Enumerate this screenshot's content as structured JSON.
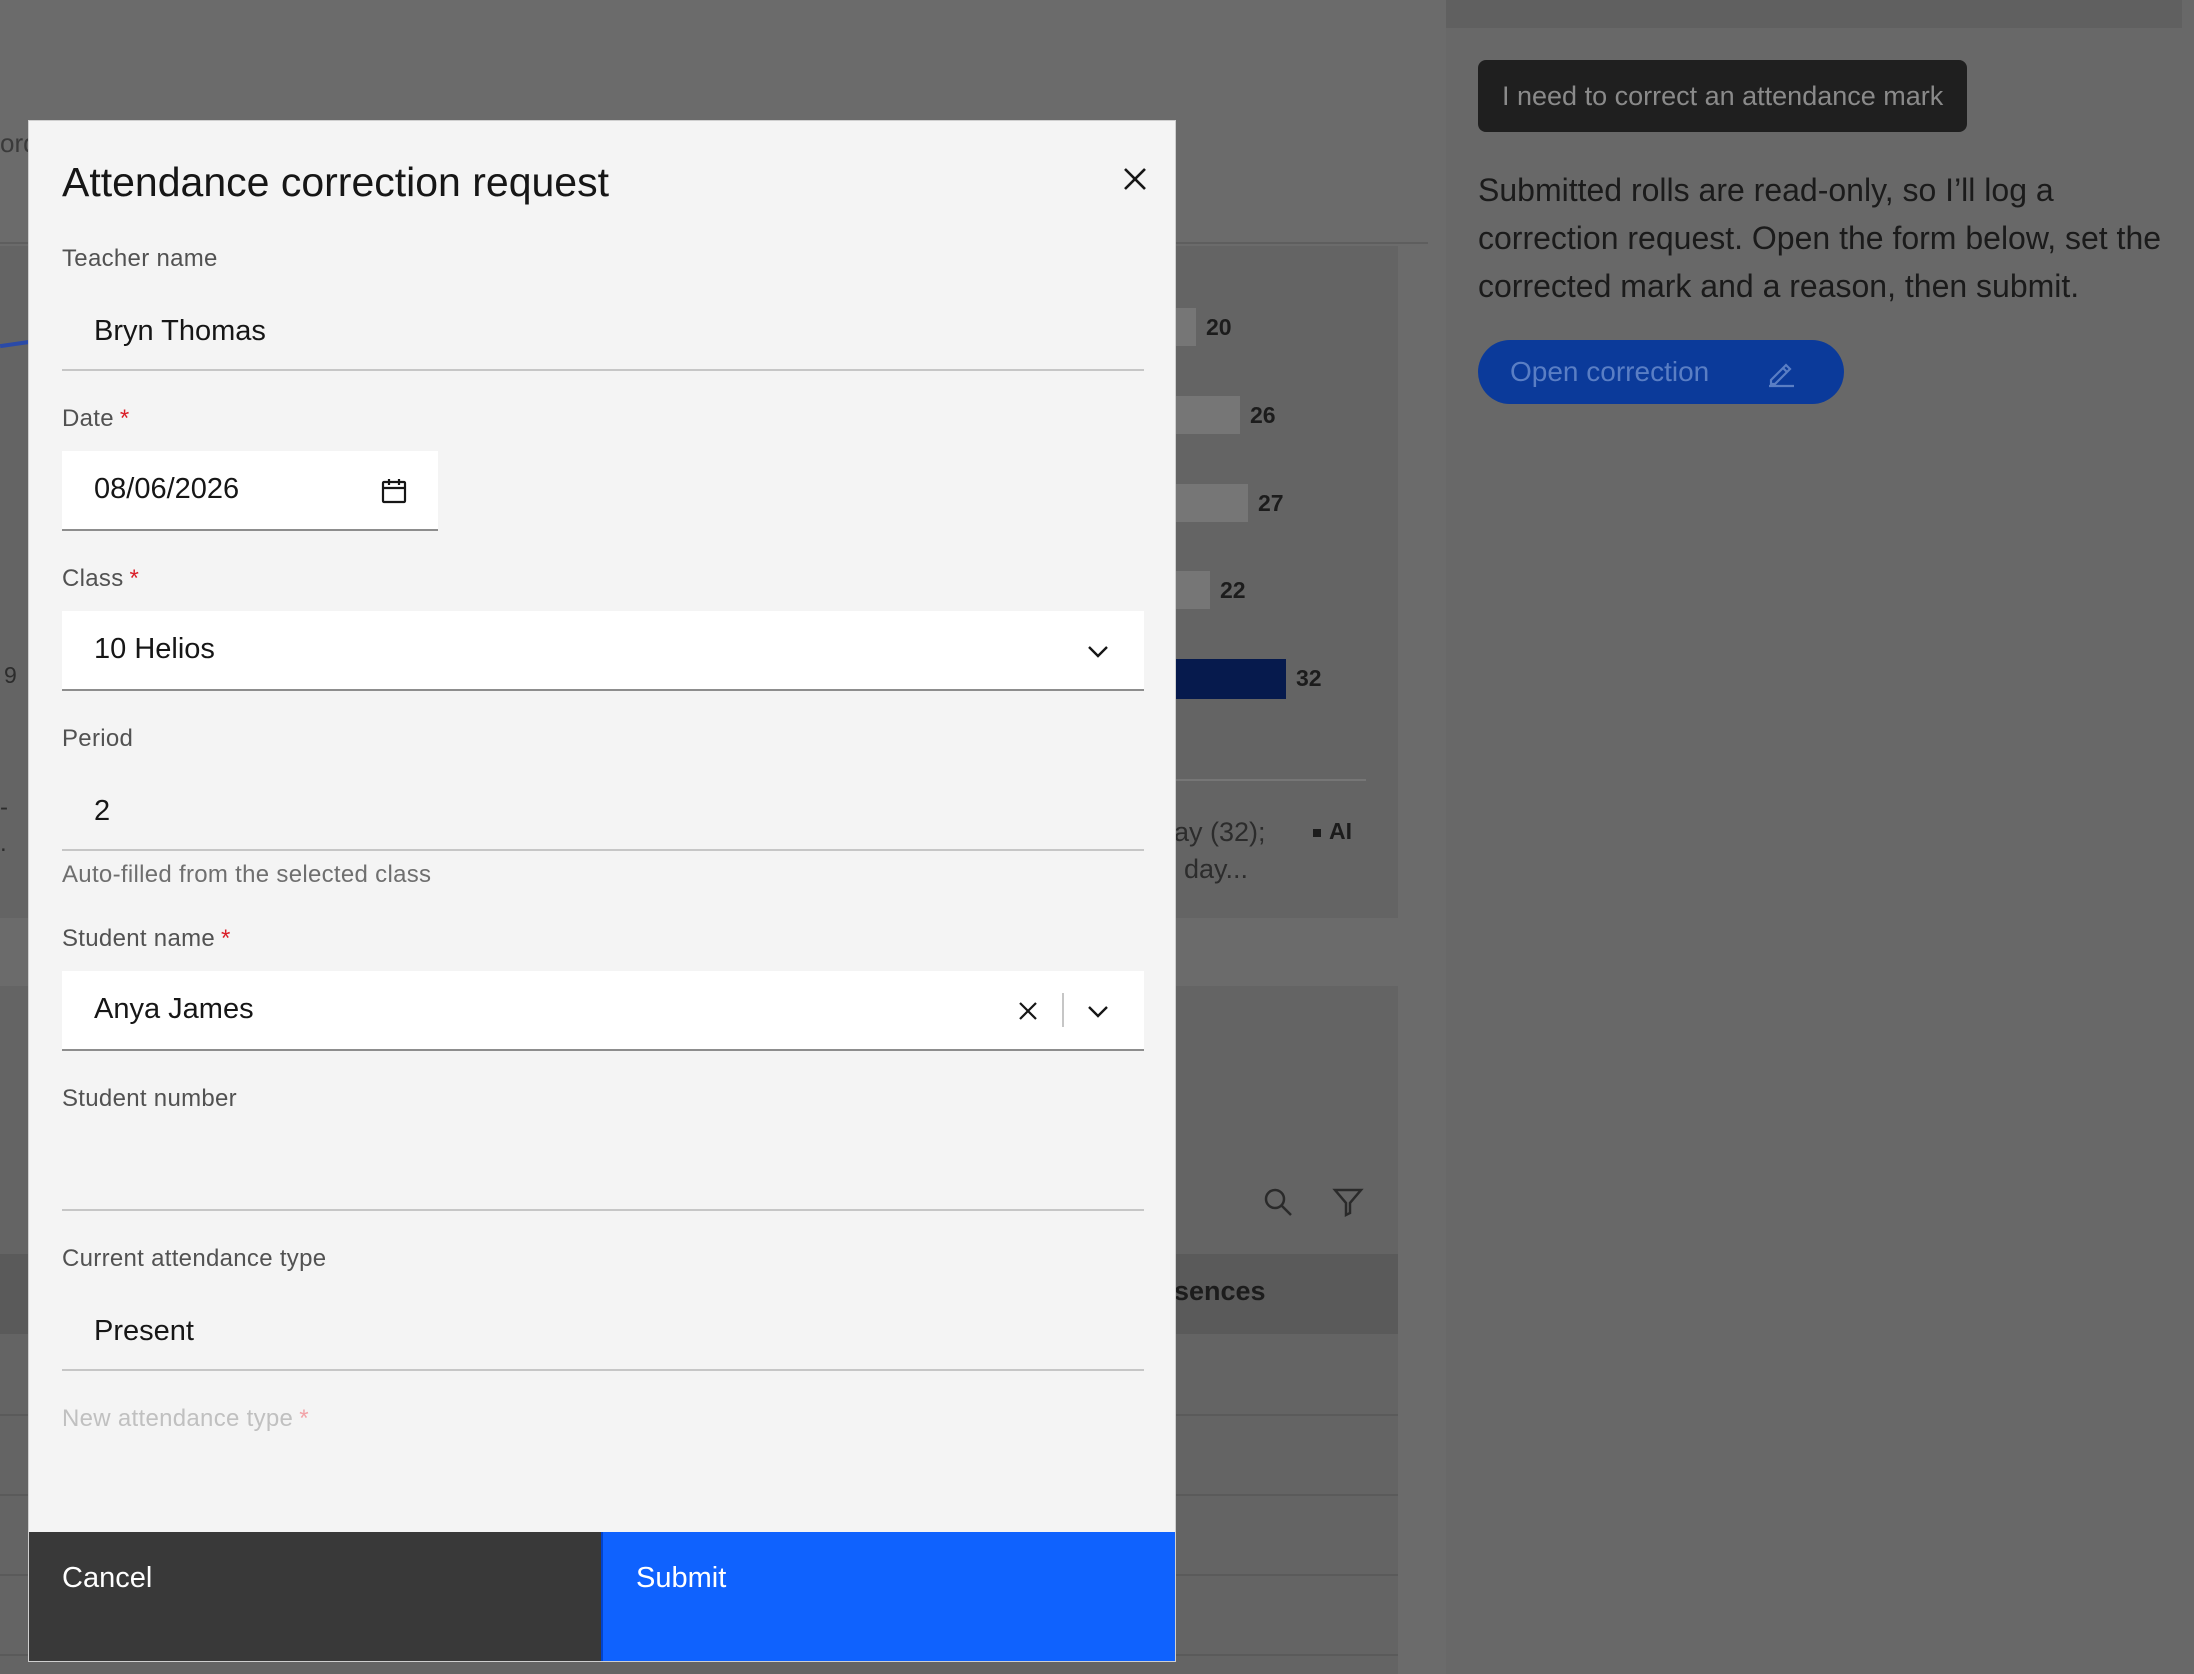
{
  "background": {
    "cut_text": "ord",
    "chart": {
      "bars": [
        {
          "value": "20"
        },
        {
          "value": "26"
        },
        {
          "value": "27"
        },
        {
          "value": "22"
        },
        {
          "value": "32",
          "highlighted": true
        }
      ],
      "axis_fragment": "9",
      "summary_line1": "ay (32);",
      "summary_line2": "day...",
      "ai_tag": "AI",
      "left_fragment": "-\n."
    },
    "table": {
      "column_header": "sences"
    },
    "accent_color": "#061a4d"
  },
  "side_panel": {
    "user_message": "I need to correct an attendance mark",
    "assistant_message": "Submitted rolls are read-only, so I’ll log a correction request. Open the form below, set the corrected mark and a reason, then submit.",
    "open_button": "Open correction",
    "open_button_icon": "pencil-icon"
  },
  "modal": {
    "title": "Attendance correction request",
    "close_icon": "close-icon",
    "fields": {
      "teacher": {
        "label": "Teacher name",
        "value": "Bryn Thomas"
      },
      "date": {
        "label": "Date",
        "required": "*",
        "value": "08/06/2026",
        "icon": "calendar-icon"
      },
      "class": {
        "label": "Class",
        "required": "*",
        "value": "10 Helios",
        "icon": "chevron-down-icon"
      },
      "period": {
        "label": "Period",
        "value": "2",
        "helper": "Auto-filled from the selected class"
      },
      "student_name": {
        "label": "Student name",
        "required": "*",
        "value": "Anya James"
      },
      "student_number": {
        "label": "Student number",
        "value": ""
      },
      "current_type": {
        "label": "Current attendance type",
        "value": "Present"
      },
      "new_type": {
        "label": "New attendance type",
        "required": "*"
      }
    },
    "buttons": {
      "cancel": "Cancel",
      "submit": "Submit"
    },
    "colors": {
      "primary": "#0f62fe",
      "secondary": "#393939",
      "required": "#da1e28"
    }
  }
}
